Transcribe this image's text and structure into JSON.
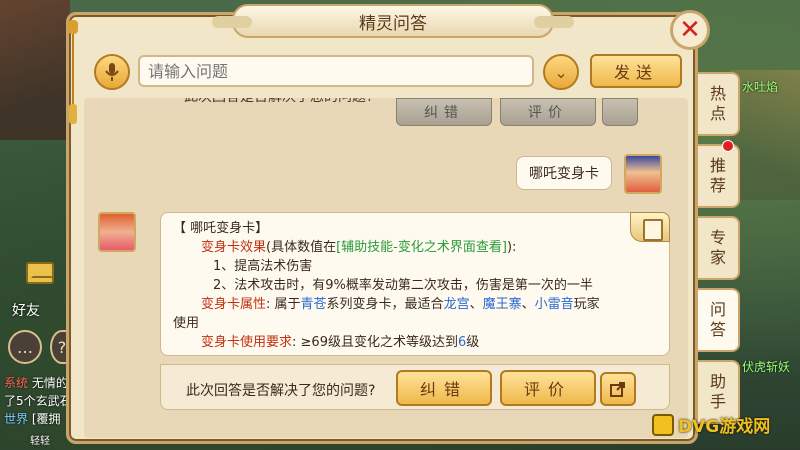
{
  "window": {
    "title": "精灵问答"
  },
  "input_row": {
    "placeholder": "请输入问题",
    "send_label": "发送"
  },
  "previous_answer_row": {
    "partial_text": "此次回答是否解决了您的问题?",
    "correct_label": "纠错",
    "rate_label": "评价"
  },
  "user_message": {
    "text": "哪吒变身卡"
  },
  "answer": {
    "heading": "【 哪吒变身卡】",
    "effect_label": "变身卡效果",
    "effect_pre": "(具体数值在",
    "effect_link": "[辅助技能-变化之术界面查看]",
    "effect_post": "):",
    "item1": "1、提高法术伤害",
    "item2": "2、法术攻击时，有9%概率发动第二次攻击，伤害是第一次的一半",
    "attr_label": "变身卡属性",
    "attr_pre": ": 属于",
    "attr_series": "青苍",
    "attr_mid": "系列变身卡，最适合",
    "attr_school1": "龙宫",
    "attr_sep1": "、",
    "attr_school2": "魔王寨",
    "attr_sep2": "、",
    "attr_school3": "小雷音",
    "attr_post": "玩家",
    "attr_line2": "使用",
    "req_label": "变身卡使用要求",
    "req_pre": ": ≥69级且变化之术等级达到",
    "req_level": "6",
    "req_post": "级"
  },
  "feedback": {
    "question": "此次回答是否解决了您的问题?",
    "correct_label": "纠错",
    "rate_label": "评价"
  },
  "side_tabs": [
    {
      "label_1": "热",
      "label_2": "点"
    },
    {
      "label_1": "推",
      "label_2": "荐"
    },
    {
      "label_1": "专",
      "label_2": "家"
    },
    {
      "label_1": "问",
      "label_2": "答"
    },
    {
      "label_1": "助",
      "label_2": "手"
    }
  ],
  "game_ui": {
    "friends_label": "好友",
    "chat_line_1_tag": "系统",
    "chat_line_1_text": "无情的",
    "chat_line_2_text": "了5个玄武石",
    "chat_line_3_tag": "世界",
    "chat_line_3_text": "[覆拥",
    "chat_line_4_text": "轻轻",
    "right_name_1": "水吐焰",
    "right_name_2": "伏虎斩妖"
  },
  "watermark": {
    "text": "DVG游戏网"
  },
  "colors": {
    "panel_bg": "#f2e6c8",
    "border": "#c9a56a",
    "button_gold": "#f0b84a",
    "label_red": "#c03010",
    "link_green": "#2a9a3a",
    "link_blue": "#2a6ad0",
    "close_red": "#d02020"
  },
  "icons": {
    "mic": "microphone-icon",
    "dropdown": "chevron-down-icon",
    "close": "close-icon",
    "share": "share-icon",
    "scroll": "scroll-icon",
    "mail": "mail-icon"
  }
}
